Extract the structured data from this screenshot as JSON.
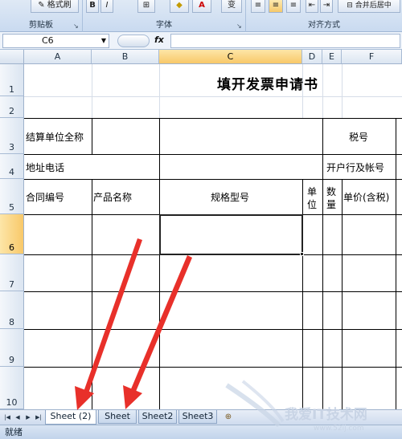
{
  "ribbon": {
    "clipboard": {
      "group_label": "剪贴板",
      "format_painter_label": "格式刷"
    },
    "font": {
      "group_label": "字体",
      "bold": "B",
      "italic": "I",
      "font_color": "A"
    },
    "alignment": {
      "group_label": "对齐方式",
      "merge_label": "合并后居中"
    }
  },
  "formula_bar": {
    "name_box": "C6",
    "fx_label": "fx",
    "formula": ""
  },
  "columns": [
    "A",
    "B",
    "C",
    "D",
    "E",
    "F"
  ],
  "rows": [
    "1",
    "2",
    "3",
    "4",
    "5",
    "6",
    "7",
    "8",
    "9",
    "10"
  ],
  "active_cell": {
    "column": "C",
    "row": "6"
  },
  "sheet": {
    "title": "填开发票申请书",
    "settlement_unit": "结算单位全称",
    "tax_number": "税号",
    "address_phone": "地址电话",
    "bank_account": "开户行及帐号",
    "contract_no": "合同编号",
    "product_name": "产品名称",
    "spec_model": "规格型号",
    "unit_line1": "单",
    "unit_line2": "位",
    "qty_line1": "数",
    "qty_line2": "量",
    "unit_price": "单价(含税)"
  },
  "sheet_tabs": [
    "Sheet (2)",
    "Sheet",
    "Sheet2",
    "Sheet3"
  ],
  "active_tab": "Sheet (2)",
  "status_text": "就绪",
  "watermark": {
    "text": "我爱IT技术网",
    "url": "www.52ij.com"
  },
  "colors": {
    "arrow": "#e8302a",
    "selection_header": "#f8c869",
    "ribbon": "#c9daf0"
  }
}
